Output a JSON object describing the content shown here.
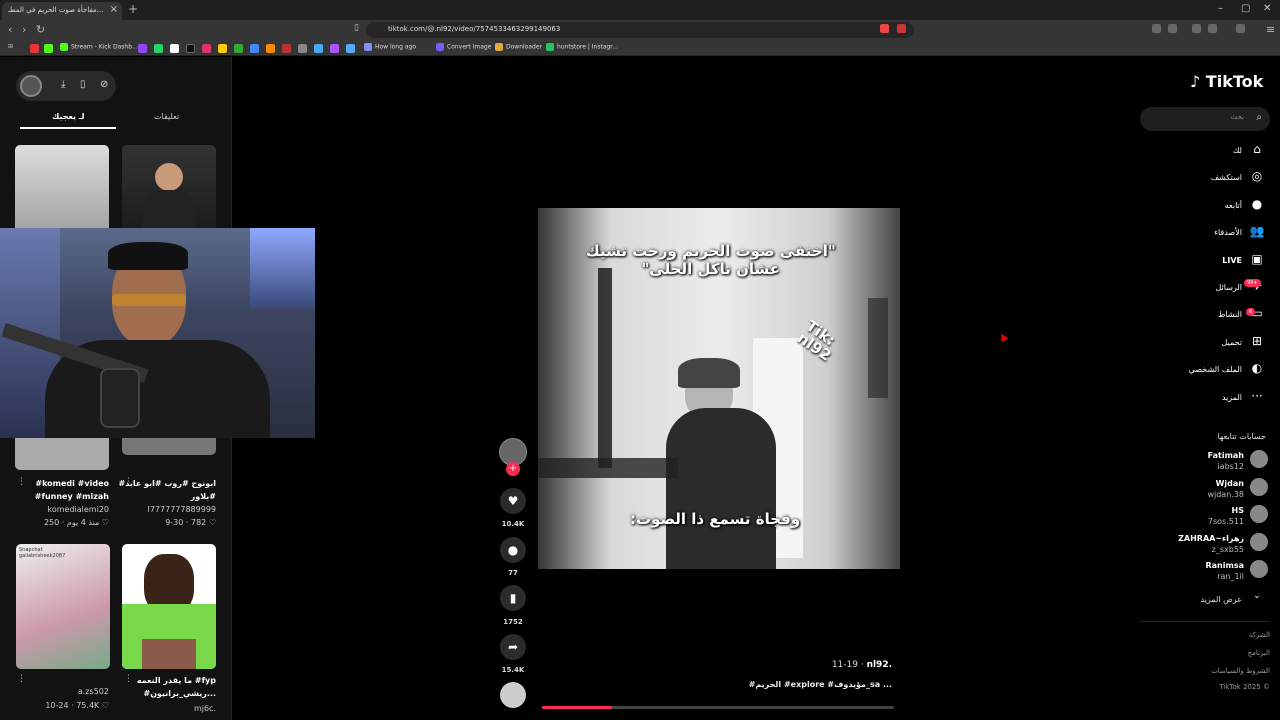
{
  "browser": {
    "tab_title": "مفاجأة صوت الحريم في المطـ...",
    "tab_close": "×",
    "new_tab": "+",
    "url": "tiktok.com/@.nl92/video/7574533463299149063",
    "window_controls": [
      "–",
      "▢",
      "✕"
    ],
    "bookmarks": [
      {
        "label": "Stream - Kick Dashb...",
        "color": "#53fc18"
      },
      {
        "label": "How long ago",
        "color": "#8888ff"
      },
      {
        "label": "Convert Image",
        "color": "#7a5af8"
      },
      {
        "label": "Downloader",
        "color": "#ddaa44"
      },
      {
        "label": "huntstore | Instagr...",
        "color": "#22c55e"
      }
    ]
  },
  "left_panel": {
    "tabs": [
      "لـ يعجبك",
      "تعليقات"
    ],
    "thumbs": [
      {
        "caption": "#komedi #video\n#funney #mizah",
        "author": "komedialemi20",
        "likes": "250",
        "age": "منذ 4 يوم"
      },
      {
        "caption": "#ابونوح #روب #ابو عابد\n#بلاور",
        "author": "I7777777889999",
        "likes": "782",
        "age": "9-30"
      },
      {
        "caption": "",
        "author": "a.zs502",
        "likes": "75.4K",
        "age": "10-24",
        "sub": "Snapchat\ngaliabrisheek2087"
      },
      {
        "caption": "ما يقدر النعمه #fyp\n#ريشي_برانيون...",
        "author": "mj6c.",
        "likes": "",
        "age": ""
      }
    ]
  },
  "video": {
    "caption_top": "\"اختفى صوت الحريم ورحت تشيك\nعشان تاكل الحلى\"",
    "caption_bottom": "وفجاة تسمع ذا الصوت:",
    "watermark": "Tik:\nnl92",
    "author": "nl92.",
    "date": "11-19",
    "description": "#الحريم #explore #مؤيدوف_sa ...",
    "progress": 0.2
  },
  "actions": {
    "likes": "10.4K",
    "comments": "77",
    "saves": "1752",
    "shares": "15.4K"
  },
  "nav": {
    "logo": "TikTok",
    "search_placeholder": "بحث",
    "items": [
      {
        "label": "لك",
        "icon": "⌂",
        "name": "home-icon"
      },
      {
        "label": "استكشف",
        "icon": "◎",
        "name": "compass-icon"
      },
      {
        "label": "أتابعه",
        "icon": "●",
        "name": "following-icon"
      },
      {
        "label": "الأصدقاء",
        "icon": "👥",
        "name": "friends-icon"
      },
      {
        "label": "LIVE",
        "icon": "▣",
        "name": "live-icon"
      },
      {
        "label": "الرسائل",
        "icon": "✈",
        "name": "messages-icon"
      },
      {
        "label": "النشاط",
        "icon": "▭",
        "name": "activity-icon"
      },
      {
        "label": "تحميل",
        "icon": "⊞",
        "name": "upload-icon"
      },
      {
        "label": "الملف الشخصي",
        "icon": "◐",
        "name": "profile-icon"
      },
      {
        "label": "المزيد",
        "icon": "···",
        "name": "more-icon"
      }
    ],
    "messages_badge": "99+",
    "activity_badge": "6",
    "following_title": "حسابات تتابعها",
    "following": [
      {
        "name": "Fatimah",
        "handle": "iabs12"
      },
      {
        "name": "Wjdan",
        "handle": "wjdan.38"
      },
      {
        "name": "HS",
        "handle": "7sos.511"
      },
      {
        "name": "ZAHRAA~زهراء",
        "handle": "z_sxb55"
      },
      {
        "name": "Ranimsa",
        "handle": "ran_1il"
      }
    ],
    "see_more": "عرض المزيد",
    "footer": [
      "الشركة",
      "البرنامج",
      "الشروط والسياسات",
      "TikTok 2025 ©"
    ]
  }
}
